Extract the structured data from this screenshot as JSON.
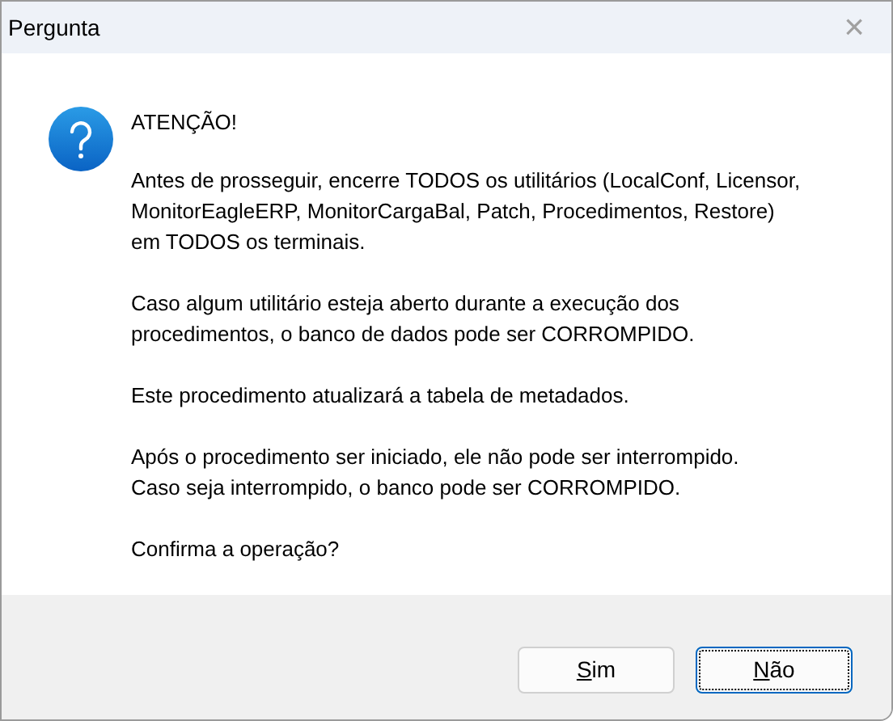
{
  "window": {
    "title": "Pergunta",
    "close": "×"
  },
  "message": {
    "heading": "ATENÇÃO!",
    "paragraphs": [
      {
        "lines": [
          "Antes de prosseguir, encerre TODOS os utilitários (LocalConf, Licensor,",
          "MonitorEagleERP, MonitorCargaBal, Patch, Procedimentos, Restore)",
          "em TODOS os terminais."
        ]
      },
      {
        "lines": [
          "Caso algum utilitário esteja aberto durante a execução dos",
          "procedimentos, o banco de dados pode ser CORROMPIDO."
        ]
      },
      {
        "lines": [
          "Este procedimento atualizará a tabela de metadados."
        ]
      },
      {
        "lines": [
          "Após o procedimento ser iniciado, ele não pode ser interrompido.",
          "Caso seja interrompido, o banco pode ser CORROMPIDO."
        ]
      },
      {
        "lines": [
          "Confirma a operação?"
        ]
      }
    ]
  },
  "buttons": [
    {
      "mnemonic": "S",
      "rest": "im",
      "focused": false
    },
    {
      "mnemonic": "N",
      "rest": "ão",
      "focused": true
    }
  ]
}
